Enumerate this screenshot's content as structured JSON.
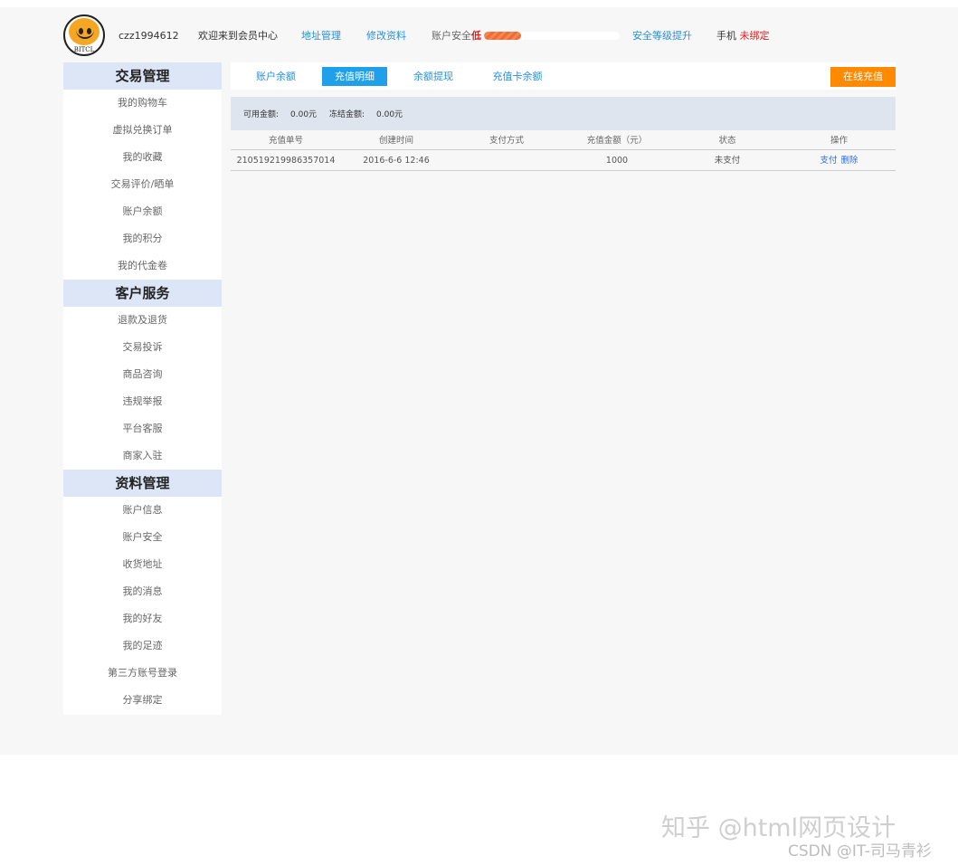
{
  "header": {
    "username": "czz1994612",
    "welcome": "欢迎来到会员中心",
    "address_link": "地址管理",
    "edit_profile_link": "修改资料",
    "security_label": "账户安全",
    "security_level": "低",
    "security_progress": 0.27,
    "upgrade_link": "安全等级提升",
    "phone_label": "手机",
    "phone_status": "未绑定"
  },
  "sidebar": {
    "sections": [
      {
        "title": "交易管理",
        "items": [
          "我的购物车",
          "虚拟兑换订单",
          "我的收藏",
          "交易评价/晒单",
          "账户余额",
          "我的积分",
          "我的代金卷"
        ]
      },
      {
        "title": "客户服务",
        "items": [
          "退款及退货",
          "交易投诉",
          "商品咨询",
          "违规举报",
          "平台客服",
          "商家入驻"
        ]
      },
      {
        "title": "资料管理",
        "items": [
          "账户信息",
          "账户安全",
          "收货地址",
          "我的消息",
          "我的好友",
          "我的足迹",
          "第三方账号登录",
          "分享绑定"
        ]
      }
    ]
  },
  "tabs": {
    "items": [
      "账户余额",
      "充值明细",
      "余额提现",
      "充值卡余额"
    ],
    "active_index": 1,
    "recharge_button": "在线充值"
  },
  "balance": {
    "available_label": "可用金额:",
    "available_value": "0.00元",
    "frozen_label": "冻结金额:",
    "frozen_value": "0.00元"
  },
  "table": {
    "columns": [
      "充值单号",
      "创建时间",
      "支付方式",
      "充值金额（元）",
      "状态",
      "操作"
    ],
    "rows": [
      {
        "order_no": "210519219986357014",
        "created": "2016-6-6 12:46",
        "method": "",
        "amount": "1000",
        "status": "未支付",
        "actions": [
          "支付",
          "删除"
        ]
      }
    ]
  },
  "watermark": "知乎 @html网页设计",
  "credit": "CSDN @IT-司马青衫",
  "colors": {
    "accent_blue": "#1fa0e8",
    "link_blue": "#2a8fd8",
    "orange": "#ff8a00",
    "danger_red": "#e02020",
    "section_header_bg": "#dde6f6"
  }
}
